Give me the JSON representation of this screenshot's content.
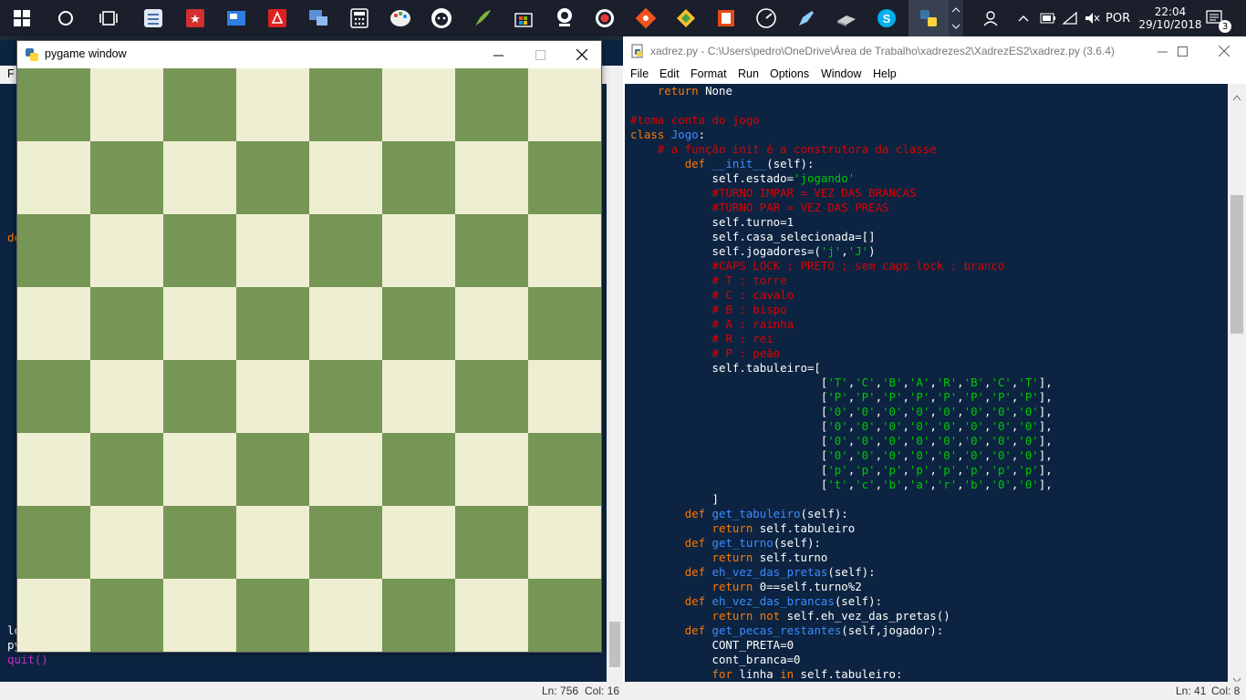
{
  "taskbar": {
    "icons": [
      "windows-start",
      "cortana",
      "task-view",
      "notes",
      "bookmark",
      "news",
      "acrobat",
      "network",
      "calculator",
      "paint",
      "github",
      "feather",
      "store",
      "camera",
      "record",
      "git",
      "mixer",
      "office",
      "dashboard",
      "pen",
      "driver",
      "skype",
      "python"
    ],
    "lang": "POR",
    "time": "22:04",
    "date": "29/10/2018",
    "notif_count": "3"
  },
  "shell": {
    "menu_stub": "F",
    "stub_def": "de",
    "stub_lines": [
      "lo",
      "py",
      "quit()"
    ],
    "status": {
      "ln": "Ln: 756",
      "col": "Col: 16"
    }
  },
  "pygame": {
    "title": "pygame window",
    "board": {
      "light": "#eeeed2",
      "dark": "#769656"
    }
  },
  "editor": {
    "title": "xadrez.py - C:\\Users\\pedro\\OneDrive\\Área de Trabalho\\xadrezes2\\XadrezES2\\xadrez.py (3.6.4)",
    "menu": [
      "File",
      "Edit",
      "Format",
      "Run",
      "Options",
      "Window",
      "Help"
    ],
    "status": {
      "ln": "Ln: 41",
      "col": "Col: 8"
    },
    "code": [
      [
        [
          "tx",
          "    "
        ],
        [
          "kw",
          "return"
        ],
        [
          "tx",
          " None"
        ]
      ],
      [
        [
          "tx",
          ""
        ]
      ],
      [
        [
          "cm",
          "#toma conta do jogo"
        ]
      ],
      [
        [
          "kw",
          "class"
        ],
        [
          "tx",
          " "
        ],
        [
          "fn",
          "Jogo"
        ],
        [
          "tx",
          ":"
        ]
      ],
      [
        [
          "tx",
          "    "
        ],
        [
          "cm",
          "# a função init é a construtora da classe"
        ]
      ],
      [
        [
          "tx",
          "        "
        ],
        [
          "kw",
          "def"
        ],
        [
          "tx",
          " "
        ],
        [
          "fn",
          "__init__"
        ],
        [
          "tx",
          "(self):"
        ]
      ],
      [
        [
          "tx",
          "            self.estado="
        ],
        [
          "st",
          "'jogando'"
        ]
      ],
      [
        [
          "tx",
          "            "
        ],
        [
          "cm",
          "#TURNO IMPAR = VEZ DAS BRANCAS"
        ]
      ],
      [
        [
          "tx",
          "            "
        ],
        [
          "cm",
          "#TURNO PAR = VEZ DAS PREAS"
        ]
      ],
      [
        [
          "tx",
          "            self.turno=1"
        ]
      ],
      [
        [
          "tx",
          "            self.casa_selecionada=[]"
        ]
      ],
      [
        [
          "tx",
          "            self.jogadores=("
        ],
        [
          "st",
          "'j'"
        ],
        [
          "tx",
          ","
        ],
        [
          "st",
          "'J'"
        ],
        [
          "tx",
          ")"
        ]
      ],
      [
        [
          "tx",
          "            "
        ],
        [
          "cm",
          "#CAPS LOCK : PRETO ; sem caps lock : branco"
        ]
      ],
      [
        [
          "tx",
          "            "
        ],
        [
          "cm",
          "# T : torre"
        ]
      ],
      [
        [
          "tx",
          "            "
        ],
        [
          "cm",
          "# C : cavalo"
        ]
      ],
      [
        [
          "tx",
          "            "
        ],
        [
          "cm",
          "# B : bispo"
        ]
      ],
      [
        [
          "tx",
          "            "
        ],
        [
          "cm",
          "# A : rainha"
        ]
      ],
      [
        [
          "tx",
          "            "
        ],
        [
          "cm",
          "# R : rei"
        ]
      ],
      [
        [
          "tx",
          "            "
        ],
        [
          "cm",
          "# P : peão"
        ]
      ],
      [
        [
          "tx",
          "            self.tabuleiro=["
        ]
      ],
      [
        [
          "tx",
          "                            ["
        ],
        [
          "st",
          "'T'"
        ],
        [
          "tx",
          ","
        ],
        [
          "st",
          "'C'"
        ],
        [
          "tx",
          ","
        ],
        [
          "st",
          "'B'"
        ],
        [
          "tx",
          ","
        ],
        [
          "st",
          "'A'"
        ],
        [
          "tx",
          ","
        ],
        [
          "st",
          "'R'"
        ],
        [
          "tx",
          ","
        ],
        [
          "st",
          "'B'"
        ],
        [
          "tx",
          ","
        ],
        [
          "st",
          "'C'"
        ],
        [
          "tx",
          ","
        ],
        [
          "st",
          "'T'"
        ],
        [
          "tx",
          "],"
        ]
      ],
      [
        [
          "tx",
          "                            ["
        ],
        [
          "st",
          "'P'"
        ],
        [
          "tx",
          ","
        ],
        [
          "st",
          "'P'"
        ],
        [
          "tx",
          ","
        ],
        [
          "st",
          "'P'"
        ],
        [
          "tx",
          ","
        ],
        [
          "st",
          "'P'"
        ],
        [
          "tx",
          ","
        ],
        [
          "st",
          "'P'"
        ],
        [
          "tx",
          ","
        ],
        [
          "st",
          "'P'"
        ],
        [
          "tx",
          ","
        ],
        [
          "st",
          "'P'"
        ],
        [
          "tx",
          ","
        ],
        [
          "st",
          "'P'"
        ],
        [
          "tx",
          "],"
        ]
      ],
      [
        [
          "tx",
          "                            ["
        ],
        [
          "st",
          "'0'"
        ],
        [
          "tx",
          ","
        ],
        [
          "st",
          "'0'"
        ],
        [
          "tx",
          ","
        ],
        [
          "st",
          "'0'"
        ],
        [
          "tx",
          ","
        ],
        [
          "st",
          "'0'"
        ],
        [
          "tx",
          ","
        ],
        [
          "st",
          "'0'"
        ],
        [
          "tx",
          ","
        ],
        [
          "st",
          "'0'"
        ],
        [
          "tx",
          ","
        ],
        [
          "st",
          "'0'"
        ],
        [
          "tx",
          ","
        ],
        [
          "st",
          "'0'"
        ],
        [
          "tx",
          "],"
        ]
      ],
      [
        [
          "tx",
          "                            ["
        ],
        [
          "st",
          "'0'"
        ],
        [
          "tx",
          ","
        ],
        [
          "st",
          "'0'"
        ],
        [
          "tx",
          ","
        ],
        [
          "st",
          "'0'"
        ],
        [
          "tx",
          ","
        ],
        [
          "st",
          "'0'"
        ],
        [
          "tx",
          ","
        ],
        [
          "st",
          "'0'"
        ],
        [
          "tx",
          ","
        ],
        [
          "st",
          "'0'"
        ],
        [
          "tx",
          ","
        ],
        [
          "st",
          "'0'"
        ],
        [
          "tx",
          ","
        ],
        [
          "st",
          "'0'"
        ],
        [
          "tx",
          "],"
        ]
      ],
      [
        [
          "tx",
          "                            ["
        ],
        [
          "st",
          "'0'"
        ],
        [
          "tx",
          ","
        ],
        [
          "st",
          "'0'"
        ],
        [
          "tx",
          ","
        ],
        [
          "st",
          "'0'"
        ],
        [
          "tx",
          ","
        ],
        [
          "st",
          "'0'"
        ],
        [
          "tx",
          ","
        ],
        [
          "st",
          "'0'"
        ],
        [
          "tx",
          ","
        ],
        [
          "st",
          "'0'"
        ],
        [
          "tx",
          ","
        ],
        [
          "st",
          "'0'"
        ],
        [
          "tx",
          ","
        ],
        [
          "st",
          "'0'"
        ],
        [
          "tx",
          "],"
        ]
      ],
      [
        [
          "tx",
          "                            ["
        ],
        [
          "st",
          "'0'"
        ],
        [
          "tx",
          ","
        ],
        [
          "st",
          "'0'"
        ],
        [
          "tx",
          ","
        ],
        [
          "st",
          "'0'"
        ],
        [
          "tx",
          ","
        ],
        [
          "st",
          "'0'"
        ],
        [
          "tx",
          ","
        ],
        [
          "st",
          "'0'"
        ],
        [
          "tx",
          ","
        ],
        [
          "st",
          "'0'"
        ],
        [
          "tx",
          ","
        ],
        [
          "st",
          "'0'"
        ],
        [
          "tx",
          ","
        ],
        [
          "st",
          "'0'"
        ],
        [
          "tx",
          "],"
        ]
      ],
      [
        [
          "tx",
          "                            ["
        ],
        [
          "st",
          "'p'"
        ],
        [
          "tx",
          ","
        ],
        [
          "st",
          "'p'"
        ],
        [
          "tx",
          ","
        ],
        [
          "st",
          "'p'"
        ],
        [
          "tx",
          ","
        ],
        [
          "st",
          "'p'"
        ],
        [
          "tx",
          ","
        ],
        [
          "st",
          "'p'"
        ],
        [
          "tx",
          ","
        ],
        [
          "st",
          "'p'"
        ],
        [
          "tx",
          ","
        ],
        [
          "st",
          "'p'"
        ],
        [
          "tx",
          ","
        ],
        [
          "st",
          "'p'"
        ],
        [
          "tx",
          "],"
        ]
      ],
      [
        [
          "tx",
          "                            ["
        ],
        [
          "st",
          "'t'"
        ],
        [
          "tx",
          ","
        ],
        [
          "st",
          "'c'"
        ],
        [
          "tx",
          ","
        ],
        [
          "st",
          "'b'"
        ],
        [
          "tx",
          ","
        ],
        [
          "st",
          "'a'"
        ],
        [
          "tx",
          ","
        ],
        [
          "st",
          "'r'"
        ],
        [
          "tx",
          ","
        ],
        [
          "st",
          "'b'"
        ],
        [
          "tx",
          ","
        ],
        [
          "st",
          "'0'"
        ],
        [
          "tx",
          ","
        ],
        [
          "st",
          "'0'"
        ],
        [
          "tx",
          "],"
        ]
      ],
      [
        [
          "tx",
          "            ]"
        ]
      ],
      [
        [
          "tx",
          "        "
        ],
        [
          "kw",
          "def"
        ],
        [
          "tx",
          " "
        ],
        [
          "fn",
          "get_tabuleiro"
        ],
        [
          "tx",
          "(self):"
        ]
      ],
      [
        [
          "tx",
          "            "
        ],
        [
          "kw",
          "return"
        ],
        [
          "tx",
          " self.tabuleiro"
        ]
      ],
      [
        [
          "tx",
          "        "
        ],
        [
          "kw",
          "def"
        ],
        [
          "tx",
          " "
        ],
        [
          "fn",
          "get_turno"
        ],
        [
          "tx",
          "(self):"
        ]
      ],
      [
        [
          "tx",
          "            "
        ],
        [
          "kw",
          "return"
        ],
        [
          "tx",
          " self.turno"
        ]
      ],
      [
        [
          "tx",
          "        "
        ],
        [
          "kw",
          "def"
        ],
        [
          "tx",
          " "
        ],
        [
          "fn",
          "eh_vez_das_pretas"
        ],
        [
          "tx",
          "(self):"
        ]
      ],
      [
        [
          "tx",
          "            "
        ],
        [
          "kw",
          "return"
        ],
        [
          "tx",
          " 0==self.turno%2"
        ]
      ],
      [
        [
          "tx",
          "        "
        ],
        [
          "kw",
          "def"
        ],
        [
          "tx",
          " "
        ],
        [
          "fn",
          "eh_vez_das_brancas"
        ],
        [
          "tx",
          "(self):"
        ]
      ],
      [
        [
          "tx",
          "            "
        ],
        [
          "kw",
          "return"
        ],
        [
          "tx",
          " "
        ],
        [
          "kw",
          "not"
        ],
        [
          "tx",
          " self.eh_vez_das_pretas()"
        ]
      ],
      [
        [
          "tx",
          "        "
        ],
        [
          "kw",
          "def"
        ],
        [
          "tx",
          " "
        ],
        [
          "fn",
          "get_pecas_restantes"
        ],
        [
          "tx",
          "(self,jogador):"
        ]
      ],
      [
        [
          "tx",
          "            CONT_PRETA=0"
        ]
      ],
      [
        [
          "tx",
          "            cont_branca=0"
        ]
      ],
      [
        [
          "tx",
          "            "
        ],
        [
          "kw",
          "for"
        ],
        [
          "tx",
          " linha "
        ],
        [
          "kw",
          "in"
        ],
        [
          "tx",
          " self.tabuleiro:"
        ]
      ]
    ]
  }
}
